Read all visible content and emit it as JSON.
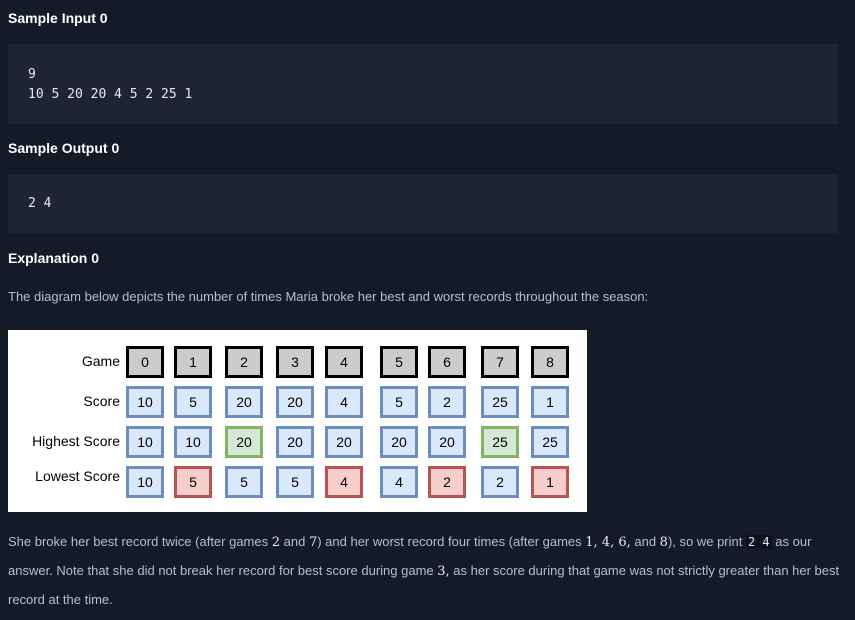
{
  "sample_input": {
    "title": "Sample Input 0",
    "lines": [
      "9",
      "10 5 20 20 4 5 2 25 1"
    ]
  },
  "sample_output": {
    "title": "Sample Output 0",
    "lines": [
      "2 4"
    ]
  },
  "explanation": {
    "title": "Explanation 0",
    "intro": "The diagram below depicts the number of times Maria broke her best and worst records throughout the season:"
  },
  "diagram": {
    "rows": [
      {
        "label": "Game",
        "kind": "game",
        "cells": [
          {
            "v": "0"
          },
          {
            "v": "1"
          },
          {
            "v": "2"
          },
          {
            "v": "3"
          },
          {
            "v": "4"
          },
          {
            "v": "5"
          },
          {
            "v": "6"
          },
          {
            "v": "7"
          },
          {
            "v": "8"
          }
        ]
      },
      {
        "label": "Score",
        "kind": "normal",
        "cells": [
          {
            "v": "10"
          },
          {
            "v": "5"
          },
          {
            "v": "20"
          },
          {
            "v": "20"
          },
          {
            "v": "4"
          },
          {
            "v": "5"
          },
          {
            "v": "2"
          },
          {
            "v": "25"
          },
          {
            "v": "1"
          }
        ]
      },
      {
        "label": "Highest Score",
        "kind": "normal",
        "cells": [
          {
            "v": "10"
          },
          {
            "v": "10"
          },
          {
            "v": "20",
            "s": "best"
          },
          {
            "v": "20"
          },
          {
            "v": "20"
          },
          {
            "v": "20"
          },
          {
            "v": "20"
          },
          {
            "v": "25",
            "s": "best"
          },
          {
            "v": "25"
          }
        ]
      },
      {
        "label": "Lowest Score",
        "kind": "normal",
        "cells": [
          {
            "v": "10"
          },
          {
            "v": "5",
            "s": "worst"
          },
          {
            "v": "5"
          },
          {
            "v": "5"
          },
          {
            "v": "4",
            "s": "worst"
          },
          {
            "v": "4"
          },
          {
            "v": "2",
            "s": "worst"
          },
          {
            "v": "2"
          },
          {
            "v": "1",
            "s": "worst"
          }
        ]
      }
    ]
  },
  "conclusion": {
    "t1": "She broke her best record twice (after games ",
    "m1": "2",
    "t2": " and ",
    "m2": "7",
    "t3": ") and her worst record four times (after games ",
    "m3": "1, 4, 6,",
    "t4": " and ",
    "m4": "8",
    "t5": "), so we print ",
    "code": "2 4",
    "t6": " as our answer. Note that she did not break her record for best score during game ",
    "m5": "3,",
    "t7": " as her score during that game was not strictly greater than her best record at the time."
  }
}
